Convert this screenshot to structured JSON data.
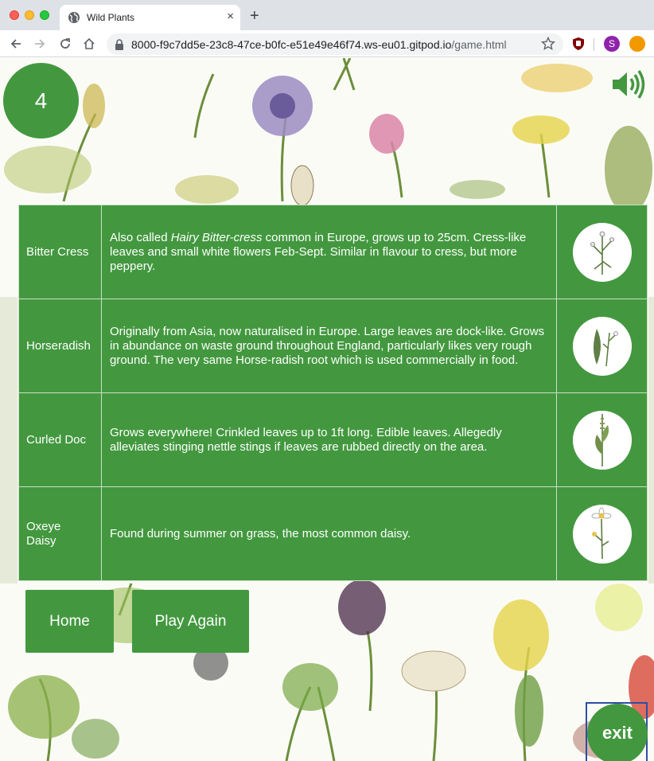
{
  "browser": {
    "tab_title": "Wild Plants",
    "tab_close": "×",
    "new_tab": "+",
    "url_host": "8000-f9c7dd5e-23c8-47ce-b0fc-e51e49e46f74.ws-eu01.gitpod.io",
    "url_path": "/game.html",
    "profile_initial": "S"
  },
  "game": {
    "score": "4",
    "sound_icon": "speaker-volume-icon"
  },
  "plants": [
    {
      "name": "Bitter Cress",
      "desc_prefix": "Also called ",
      "desc_italic": "Hairy Bitter-cress",
      "desc_rest": " common in Europe, grows up to 25cm. Cress-like leaves and small white flowers Feb-Sept. Similar in flavour to cress, but more peppery."
    },
    {
      "name": "Horseradish",
      "desc": "Originally from Asia, now naturalised in Europe. Large leaves are dock-like. Grows in abundance on waste ground throughout England, particularly likes very rough ground. The very same Horse-radish root which is used commercially in food."
    },
    {
      "name": "Curled Doc",
      "desc": "Grows everywhere! Crinkled leaves up to 1ft long. Edible leaves. Allegedly alleviates stinging nettle stings if leaves are rubbed directly on the area."
    },
    {
      "name": "Oxeye Daisy",
      "desc": "Found during summer on grass, the most common daisy."
    }
  ],
  "buttons": {
    "home": "Home",
    "play_again": "Play Again",
    "exit": "exit"
  },
  "colors": {
    "accent": "#43983f"
  }
}
